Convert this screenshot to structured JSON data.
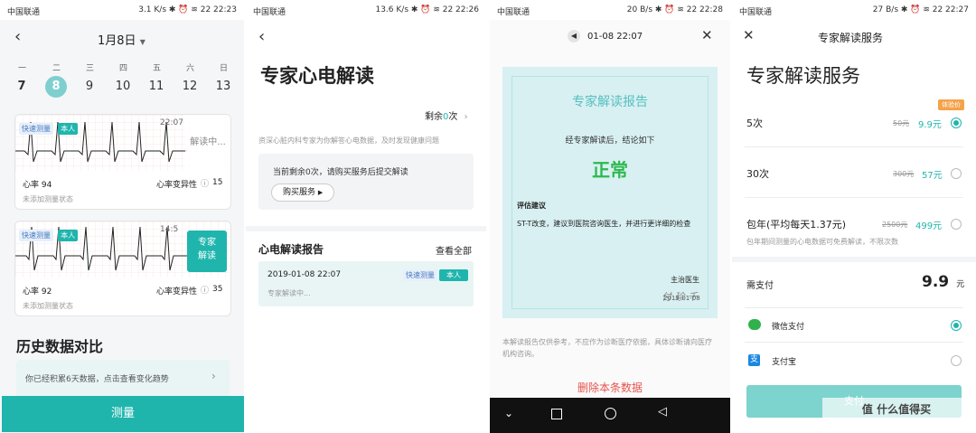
{
  "s1": {
    "status": {
      "carrier": "中国联通",
      "right": "3.1 K/s ✱ ⏰ ≋ 22 22:23"
    },
    "date_label": "1月8日",
    "weekdays": [
      "一",
      "二",
      "三",
      "四",
      "五",
      "六",
      "日"
    ],
    "days": [
      "7",
      "8",
      "9",
      "10",
      "11",
      "12",
      "13"
    ],
    "cards": [
      {
        "tag1": "快速测量",
        "tag2": "本人",
        "time": "22:07",
        "overlay": "解读中...",
        "hr": "心率 94",
        "hrv": "心率变异性",
        "hrv_value": "15",
        "status": "未添加测量状态"
      },
      {
        "tag1": "快速测量",
        "tag2": "本人",
        "time": "14:5",
        "overlay": "专家\n解读",
        "hr": "心率 92",
        "hrv": "心率变异性",
        "hrv_value": "35",
        "status": "未添加测量状态"
      }
    ],
    "history_title": "历史数据对比",
    "history_text": "你已经积累6天数据，点击查看变化趋势",
    "measure_button": "测量"
  },
  "s2": {
    "status": {
      "carrier": "中国联通",
      "right": "13.6 K/s ✱ ⏰ ≋ 22 22:26"
    },
    "title": "专家心电解读",
    "remaining_prefix": "剩余",
    "remaining_count": "0",
    "remaining_suffix": "次",
    "description": "资深心脏内科专家为你解答心电数据，及时发现健康问题",
    "notice": "当前剩余0次，请购买服务后提交解读",
    "buy_button": "购买服务",
    "reports_title": "心电解读报告",
    "view_all": "查看全部",
    "report": {
      "date": "2019-01-08 22:07",
      "tag1": "快速测量",
      "tag2": "本人",
      "status": "专家解读中..."
    }
  },
  "s3": {
    "status": {
      "carrier": "中国联通",
      "right": "20 B/s ✱ ⏰ ≋ 22 22:28"
    },
    "header_time": "01-08 22:07",
    "report_title": "专家解读报告",
    "conclusion_intro": "经专家解读后，结论如下",
    "conclusion": "正常",
    "advice_title": "评估建议",
    "advice_text": "ST-T改变，建议到医院咨询医生，并进行更详细的检查",
    "doctor_label": "主治医生",
    "signature": "付 珍 千",
    "sign_date": "2019-01-08",
    "disclaimer": "本解读报告仅供参考，不应作为诊断医疗依据，具体诊断请向医疗机构咨询。",
    "delete_button": "删除本条数据"
  },
  "s4": {
    "status": {
      "carrier": "中国联通",
      "right": "27 B/s ✱ ⏰ ≋ 22 22:27"
    },
    "header_title": "专家解读服务",
    "title": "专家解读服务",
    "badge": "体验价",
    "plans": [
      {
        "name": "5次",
        "old": "50元",
        "price": "9.9元",
        "selected": true
      },
      {
        "name": "30次",
        "old": "300元",
        "price": "57元",
        "selected": false
      },
      {
        "name": "包年(平均每天1.37元)",
        "old": "2500元",
        "price": "499元",
        "selected": false
      }
    ],
    "plan_note": "包年期间测量的心电数据可免费解读，不限次数",
    "pay_label": "需支付",
    "pay_amount": "9.9",
    "pay_unit": "元",
    "wechat": "微信支付",
    "alipay": "支付宝",
    "submit": "支付",
    "watermark": "值 什么值得买"
  }
}
